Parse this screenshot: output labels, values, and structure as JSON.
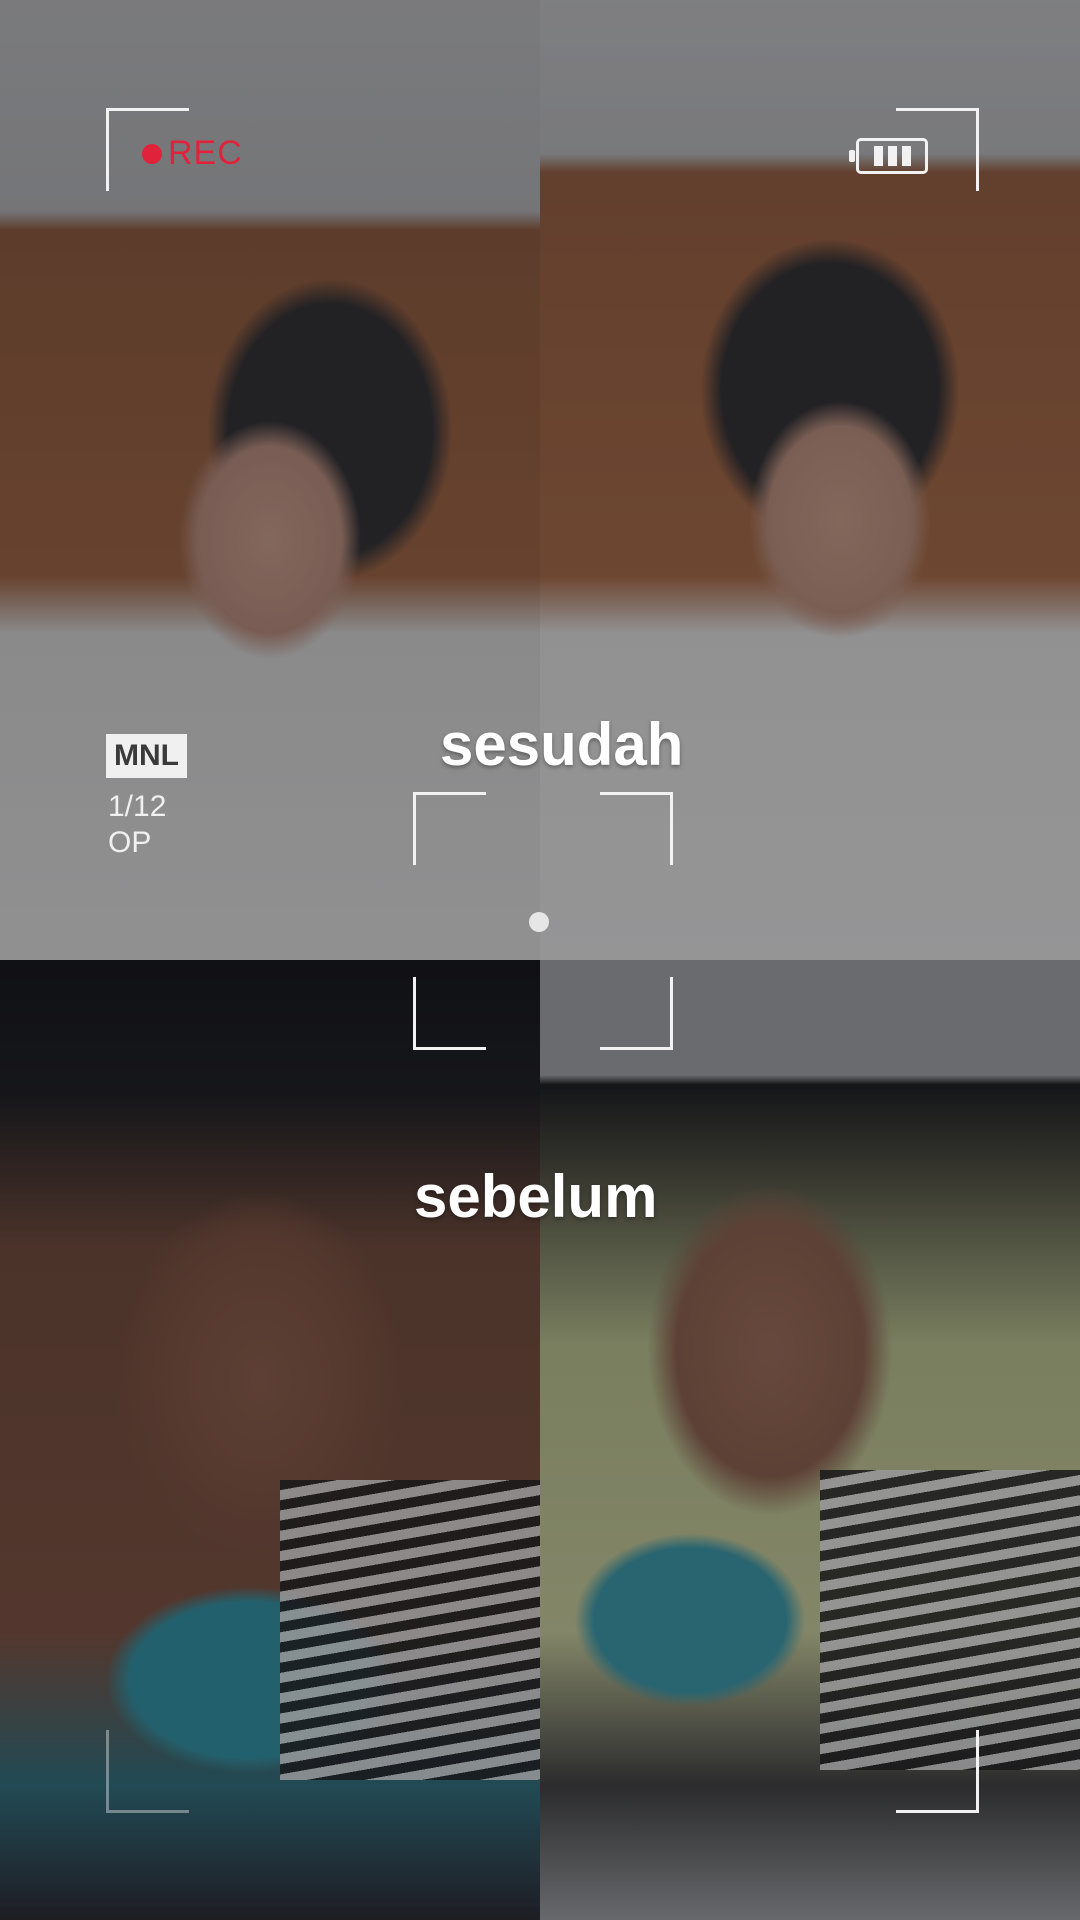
{
  "hud": {
    "rec_label": "REC",
    "mode_badge": "MNL",
    "counter": "1/12",
    "mode_sub": "OP"
  },
  "captions": {
    "after": "sesudah",
    "before": "sebelum"
  },
  "colors": {
    "rec_red": "#e0233b",
    "hud_white": "#f2f2f2",
    "caption_white": "#ffffff"
  },
  "icons": [
    "rec-dot-icon",
    "battery-icon",
    "focus-frame-icon"
  ]
}
